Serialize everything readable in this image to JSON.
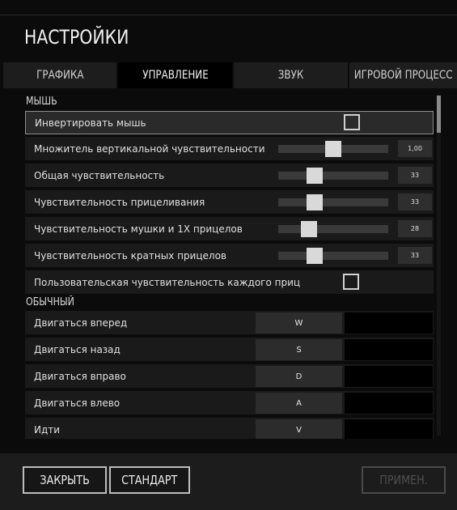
{
  "title": "НАСТРОЙКИ",
  "tabs": [
    {
      "label": "ГРАФИКА"
    },
    {
      "label": "УПРАВЛЕНИЕ",
      "active": true
    },
    {
      "label": "ЗВУК"
    },
    {
      "label": "ИГРОВОЙ ПРОЦЕСС"
    }
  ],
  "mouse": {
    "section": "МЫШЬ",
    "invert": {
      "label": "Инвертировать мышь",
      "checked": false
    },
    "vertical_multiplier": {
      "label": "Множитель вертикальной чувствительности",
      "value": "1,00",
      "fraction": 0.5
    },
    "general": {
      "label": "Общая чувствительность",
      "value": "33",
      "fraction": 0.33
    },
    "aiming": {
      "label": "Чувствительность прицеливания",
      "value": "33",
      "fraction": 0.33
    },
    "ironsight": {
      "label": "Чувствительность мушки и 1X прицелов",
      "value": "28",
      "fraction": 0.28
    },
    "scopes": {
      "label": "Чувствительность кратных прицелов",
      "value": "33",
      "fraction": 0.33
    },
    "custom": {
      "label": "Пользовательская чувствительность каждого приц",
      "checked": false
    }
  },
  "normal": {
    "section": "ОБЫЧНЫЙ",
    "bindings": [
      {
        "label": "Двигаться вперед",
        "key": "W"
      },
      {
        "label": "Двигаться назад",
        "key": "S"
      },
      {
        "label": "Двигаться вправо",
        "key": "D"
      },
      {
        "label": "Двигаться влево",
        "key": "A"
      },
      {
        "label": "Идти",
        "key": "V"
      }
    ]
  },
  "buttons": {
    "close": "ЗАКРЫТЬ",
    "default": "СТАНДАРТ",
    "apply": "ПРИМЕН."
  }
}
